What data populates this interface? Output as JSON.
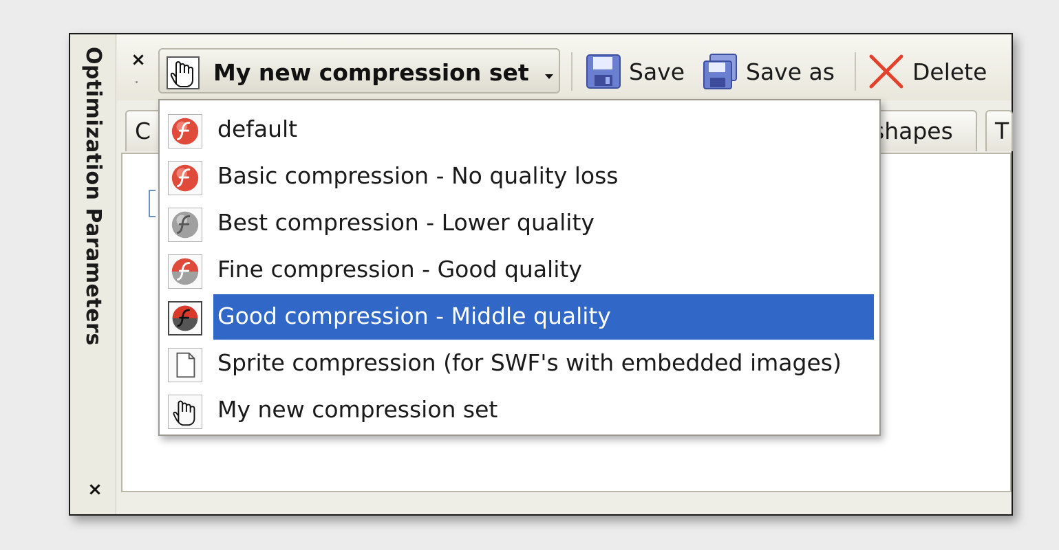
{
  "panel": {
    "title": "Optimization Parameters",
    "close_glyph": "×"
  },
  "toolbar": {
    "close_glyph": "×",
    "preset_selected": "My new compression set",
    "save_label": "Save",
    "save_as_label": "Save as",
    "delete_label": "Delete"
  },
  "tabs": [
    {
      "label": "C"
    },
    {
      "label": "shapes"
    },
    {
      "label": "T"
    }
  ],
  "dropdown": {
    "items": [
      {
        "label": "default",
        "icon": "flash-red-icon"
      },
      {
        "label": "Basic compression - No quality loss",
        "icon": "flash-red-icon"
      },
      {
        "label": "Best compression - Lower quality",
        "icon": "flash-gray-icon"
      },
      {
        "label": "Fine compression - Good quality",
        "icon": "flash-red-half-icon"
      },
      {
        "label": "Good compression - Middle quality",
        "icon": "flash-dark-icon",
        "selected": true
      },
      {
        "label": "Sprite compression (for SWF's with embedded images)",
        "icon": "document-icon"
      },
      {
        "label": "My new compression set",
        "icon": "hand-cursor-icon"
      }
    ]
  },
  "colors": {
    "selection": "#3167c6",
    "delete_red": "#e2412b",
    "disk_blue": "#6b7fd1"
  }
}
